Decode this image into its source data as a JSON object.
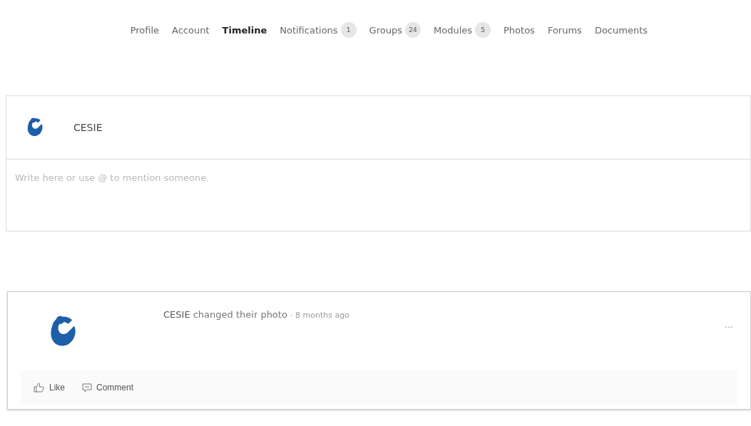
{
  "tabs": [
    {
      "label": "Profile",
      "selected": false
    },
    {
      "label": "Account",
      "selected": false
    },
    {
      "label": "Timeline",
      "selected": true
    },
    {
      "label": "Notifications",
      "count": "1",
      "selected": false
    },
    {
      "label": "Groups",
      "count": "24",
      "selected": false
    },
    {
      "label": "Modules",
      "count": "5",
      "selected": false
    },
    {
      "label": "Photos",
      "selected": false
    },
    {
      "label": "Forums",
      "selected": false
    },
    {
      "label": "Documents",
      "selected": false
    }
  ],
  "composer": {
    "user": "CESIE",
    "placeholder": "Write here or use @ to mention someone."
  },
  "activity": {
    "author": "CESIE",
    "action": "changed their photo",
    "separator": "·",
    "time": "8 months ago",
    "actions": [
      "Like",
      "Comment"
    ],
    "more": "..."
  }
}
